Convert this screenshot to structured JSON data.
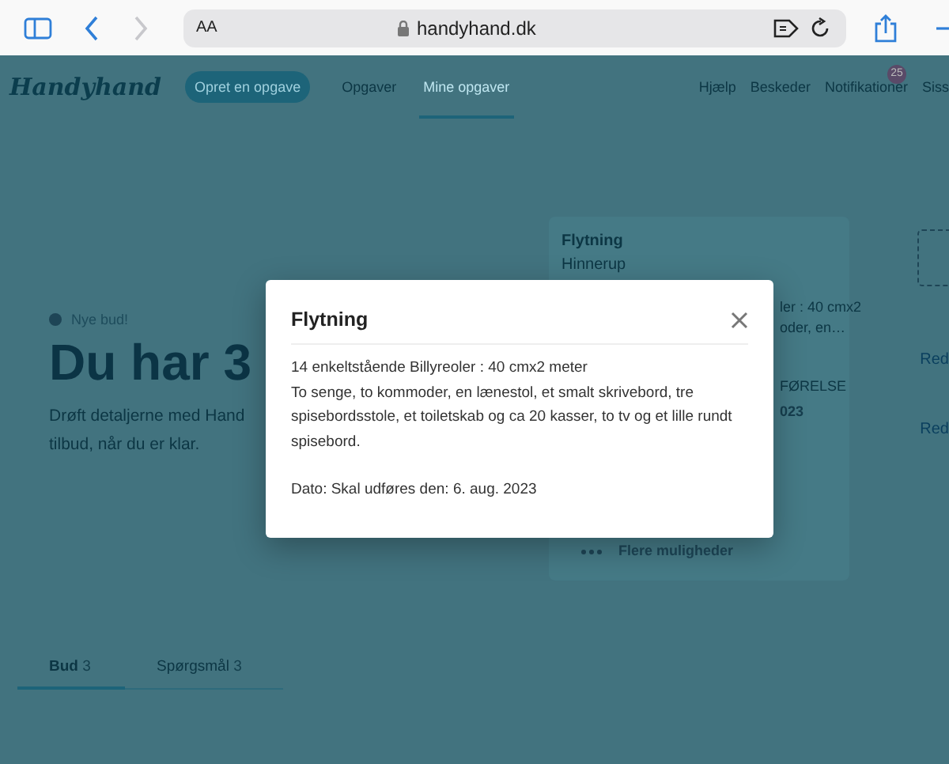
{
  "browser": {
    "text_size": "AA",
    "url": "handyhand.dk"
  },
  "nav": {
    "logo": "Handyhand",
    "cta": "Opret en opgave",
    "links": [
      {
        "label": "Opgaver",
        "selected": false
      },
      {
        "label": "Mine opgaver",
        "selected": true
      }
    ],
    "right_links": [
      "Hjælp",
      "Beskeder",
      "Notifikationer"
    ],
    "badge": "25",
    "user": "Siss"
  },
  "hero": {
    "status": "Nye bud!",
    "heading": "Du har 3",
    "text_lines": [
      "Drøft detaljerne med Hand",
      "tilbud, når du er klar."
    ]
  },
  "task_card": {
    "title": "Flytning",
    "location": "Hinnerup",
    "fragments": [
      "ler : 40 cmx2",
      "oder, en…"
    ],
    "date_label": "FØRELSE",
    "date_value": "023",
    "more": "Flere muligheder"
  },
  "side_links": [
    "Red",
    "Red"
  ],
  "tabs": [
    {
      "label": "Bud",
      "count": "3",
      "selected": true
    },
    {
      "label": "Spørgsmål",
      "count": "3",
      "selected": false
    }
  ],
  "modal": {
    "title": "Flytning",
    "lines": [
      "14 enkeltstående Billyreoler : 40 cmx2 meter",
      "To senge, to kommoder, en lænestol, et smalt skrivebord, tre spisebordsstole, et toiletskab og ca 20 kasser, to tv og et lille rundt spisebord."
    ],
    "date": "Dato: Skal udføres den: 6. aug. 2023"
  }
}
